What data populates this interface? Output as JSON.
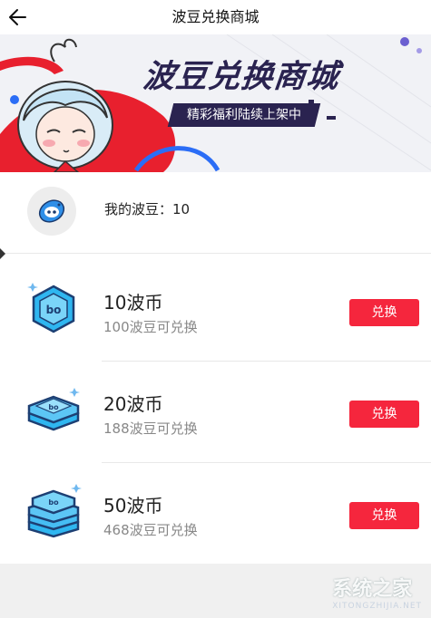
{
  "header": {
    "title": "波豆兑换商城"
  },
  "banner": {
    "title": "波豆兑换商城",
    "subtitle": "精彩福利陆续上架中"
  },
  "balance": {
    "label": "我的波豆：10"
  },
  "items": [
    {
      "name": "10波币",
      "price": "100波豆可兑换",
      "button": "兑换",
      "icon": "coin-stack-1-icon"
    },
    {
      "name": "20波币",
      "price": "188波豆可兑换",
      "button": "兑换",
      "icon": "coin-stack-2-icon"
    },
    {
      "name": "50波币",
      "price": "468波豆可兑换",
      "button": "兑换",
      "icon": "coin-stack-3-icon"
    }
  ],
  "watermark": {
    "text": "系统之家",
    "sub": "XITONGZHIJIA.NET"
  },
  "colors": {
    "accent": "#f5263d",
    "banner_dark": "#2a2350",
    "coin_blue": "#2fb6f0"
  }
}
